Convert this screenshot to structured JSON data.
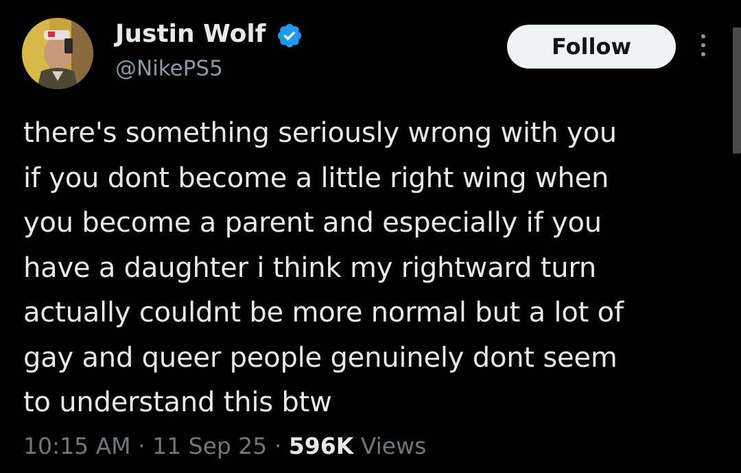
{
  "author": {
    "display_name": "Justin Wolf",
    "handle": "@NikePS5",
    "verified": true,
    "verified_color": "#1d9bf0"
  },
  "actions": {
    "follow_label": "Follow",
    "more_icon": "more-vertical-icon"
  },
  "tweet": {
    "lines": [
      "there's something seriously wrong with you",
      "if you dont become a little right wing when",
      "you become a parent and especially if you",
      "have a daughter i think my rightward turn",
      "actually couldnt be more normal but a lot of",
      "gay and queer people genuinely dont seem",
      "to understand this btw"
    ]
  },
  "meta": {
    "time": "10:15 AM",
    "separator": "·",
    "date": "11 Sep 25",
    "views_count": "596K",
    "views_label": "Views"
  },
  "colors": {
    "background": "#000000",
    "text_primary": "#e7e9ea",
    "text_secondary": "#71767b",
    "button_bg": "#eff3f4"
  }
}
